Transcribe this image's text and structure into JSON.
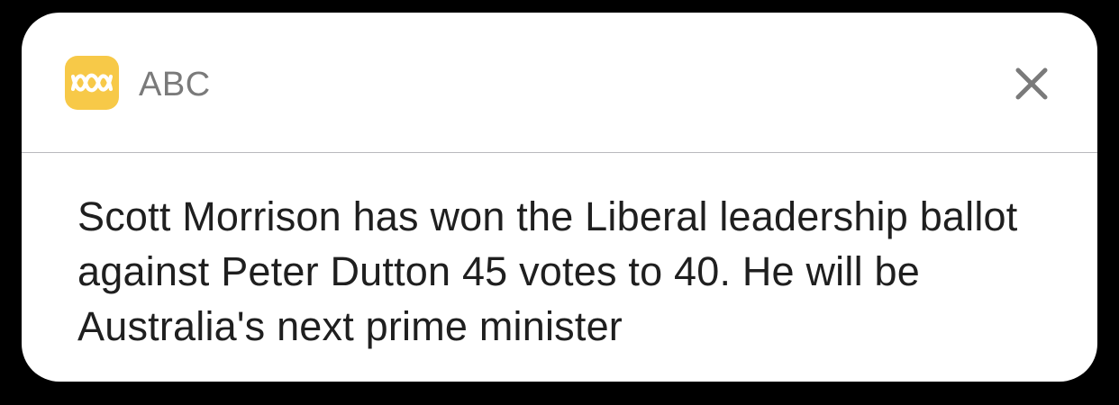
{
  "notification": {
    "app_name": "ABC",
    "app_icon": "abc-logo-icon",
    "close_icon": "close-icon",
    "message": "Scott Morrison has won the Liberal leadership ballot against Peter Dutton 45 votes to 40. He will be Australia's next prime minister",
    "colors": {
      "icon_background": "#f7c948",
      "app_name": "#7a7a7a",
      "message_text": "#1f1f1f",
      "card_background": "#ffffff",
      "screen_background": "#000000"
    }
  }
}
